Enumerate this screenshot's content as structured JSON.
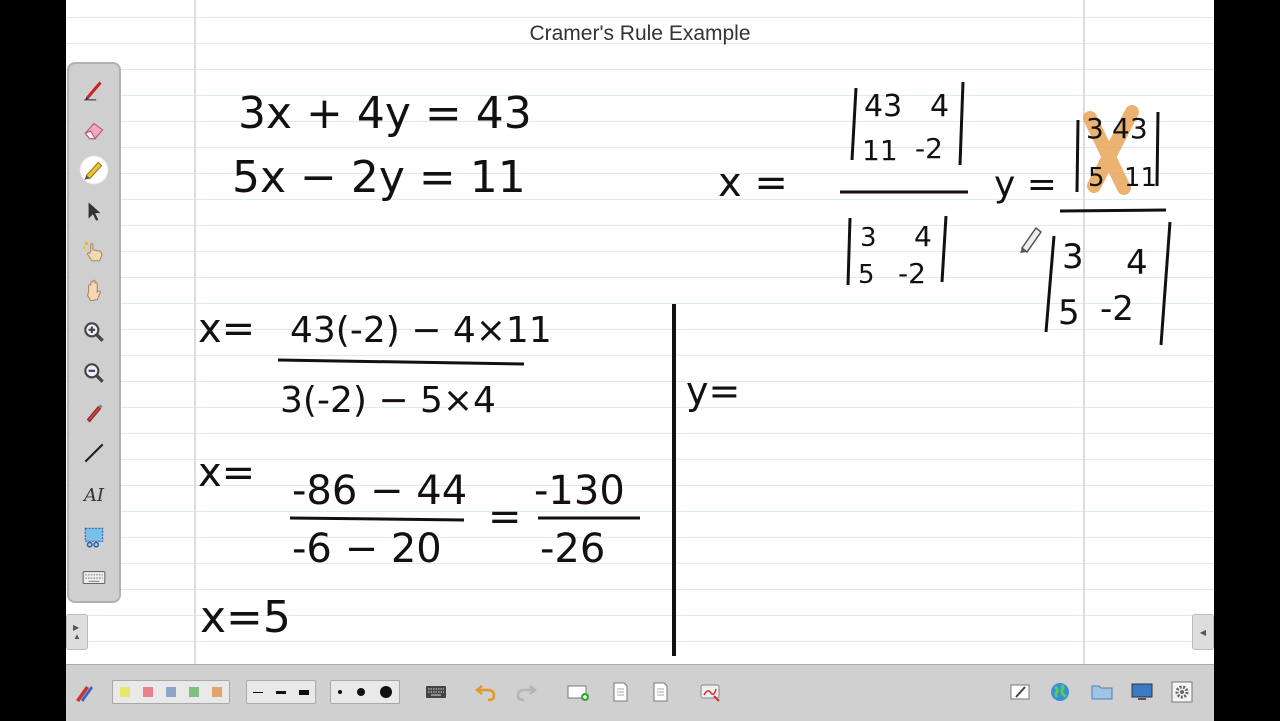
{
  "board": {
    "title": "Cramer's Rule Example",
    "equations": {
      "eq1": "3x + 4y = 43",
      "eq2": "5x − 2y = 11"
    },
    "x_formula": {
      "label": "x =",
      "num_row1": [
        "43",
        "4"
      ],
      "num_row2": [
        "11",
        "-2"
      ],
      "den_row1": [
        "3",
        "4"
      ],
      "den_row2": [
        "5",
        "-2"
      ]
    },
    "y_formula": {
      "label": "y =",
      "num_row1": [
        "3",
        "43"
      ],
      "num_row2": [
        "5",
        "11"
      ],
      "den_row1": [
        "3",
        "4"
      ],
      "den_row2": [
        "5",
        "-2"
      ]
    },
    "work": {
      "x_label": "x=",
      "step1_num": "43(-2) − 4×11",
      "step1_den": "3(-2) − 5×4",
      "step2_label": "x=",
      "step2_num": "-86 − 44",
      "step2_den": "-6 − 20",
      "equals": "=",
      "step3_num": "-130",
      "step3_den": "-26",
      "result": "x=5",
      "y_label": "y="
    },
    "colors": {
      "ink": "#111111",
      "highlight": "#e8a55a",
      "rule_line": "#d6eef3"
    }
  },
  "toolbox": {
    "tools": [
      "pen-icon",
      "eraser-icon",
      "highlighter-icon",
      "select-arrow-icon",
      "magic-pen-icon",
      "pan-hand-icon",
      "zoom-in-icon",
      "zoom-out-icon",
      "screen-pen-icon",
      "line-icon",
      "text-icon",
      "screen-capture-icon",
      "keyboard-icon"
    ],
    "text_tool_label": "AI",
    "active_tool": "highlighter-icon"
  },
  "bottom_bar": {
    "pen_colors": [
      "#e6e86a",
      "#e8828a",
      "#8aa6c8",
      "#7ec27e",
      "#e2a46a"
    ],
    "line_widths": [
      "thin",
      "medium",
      "thick"
    ],
    "dot_sizes": [
      "small",
      "medium",
      "large"
    ]
  }
}
